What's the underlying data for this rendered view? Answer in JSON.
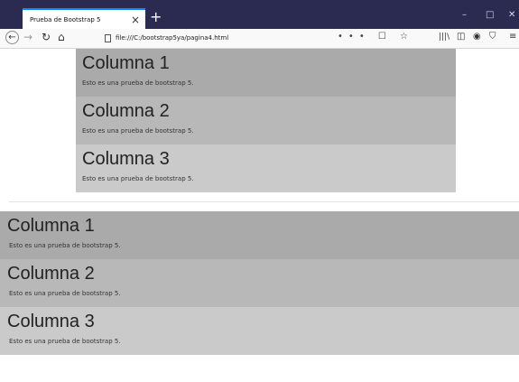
{
  "browser": {
    "tab_title": "Prueba de Bootstrap 5",
    "tab_close": "×",
    "new_tab": "+",
    "url": "file:///C:/bootstrap5ya/pagina4.html",
    "url_actions": "••• ☐ ☆",
    "window_controls": {
      "minimize": "–",
      "maximize": "□",
      "close": "✕"
    },
    "icons": {
      "back": "back-arrow-icon",
      "forward": "forward-arrow-icon",
      "reload": "reload-icon",
      "home": "home-icon",
      "page": "page-icon",
      "library": "library-icon",
      "sidebar": "sidebar-icon",
      "account": "account-icon",
      "shield": "shield-icon",
      "menu": "hamburger-menu-icon"
    }
  },
  "container": {
    "columns": [
      {
        "heading": "Columna 1",
        "text": "Esto es una prueba de bootstrap 5.",
        "bg": "#aaaaaa"
      },
      {
        "heading": "Columna 2",
        "text": "Esto es una prueba de bootstrap 5.",
        "bg": "#b8b8b8"
      },
      {
        "heading": "Columna 3",
        "text": "Esto es una prueba de bootstrap 5.",
        "bg": "#cacaca"
      }
    ]
  },
  "container_fluid": {
    "columns": [
      {
        "heading": "Columna 1",
        "text": "Esto es una prueba de bootstrap 5.",
        "bg": "#aaaaaa"
      },
      {
        "heading": "Columna 2",
        "text": "Esto es una prueba de bootstrap 5.",
        "bg": "#b8b8b8"
      },
      {
        "heading": "Columna 3",
        "text": "Esto es una prueba de bootstrap 5.",
        "bg": "#cacaca"
      }
    ]
  },
  "colors": {
    "tabbar_bg": "#2b2a50",
    "tab_accent": "#0a84ff",
    "navbar_bg": "#f9f9fa"
  }
}
